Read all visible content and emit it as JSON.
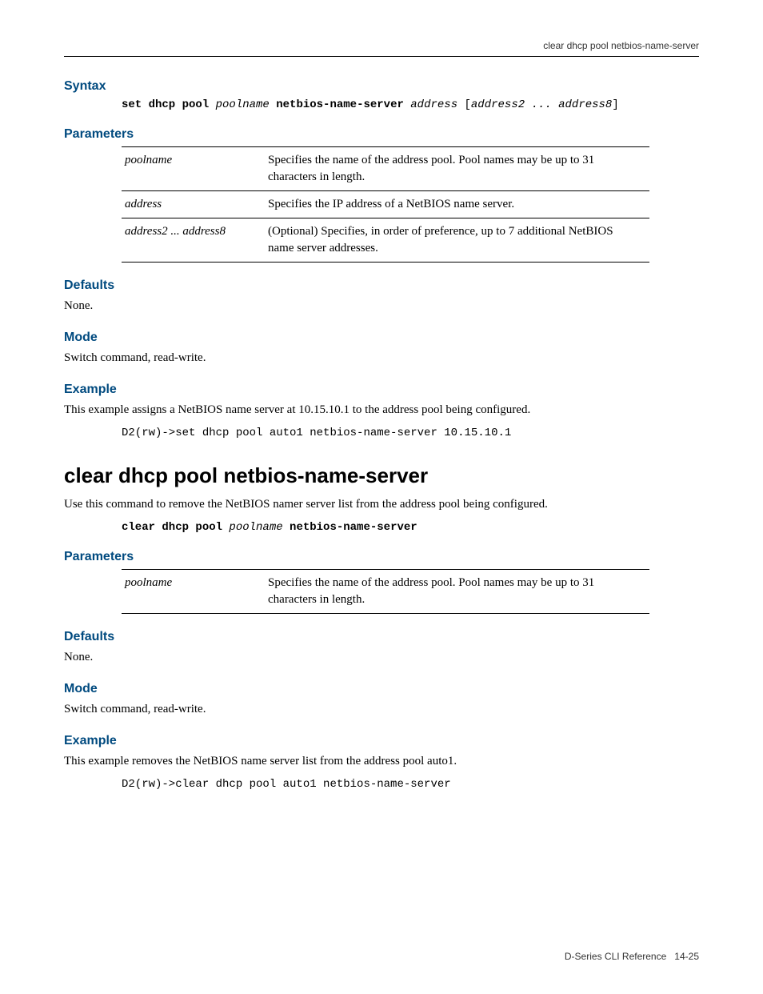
{
  "running_head": "clear dhcp pool netbios-name-server",
  "section1": {
    "syntax_head": "Syntax",
    "syntax_parts": {
      "p1": "set dhcp pool ",
      "p2": "poolname ",
      "p3": "netbios-name-server ",
      "p4": "address ",
      "p5": "[",
      "p6": "address2 ... address8",
      "p7": "]"
    },
    "params_head": "Parameters",
    "params": [
      {
        "name": "poolname",
        "desc": "Specifies the name of the address pool. Pool names may be up to 31 characters in length."
      },
      {
        "name": "address",
        "desc": "Specifies the IP address of a NetBIOS name server."
      },
      {
        "name": "address2 ... address8",
        "desc": "(Optional) Specifies, in order of preference, up to 7 additional NetBIOS name server addresses."
      }
    ],
    "defaults_head": "Defaults",
    "defaults_text": "None.",
    "mode_head": "Mode",
    "mode_text": "Switch command, read‐write.",
    "example_head": "Example",
    "example_text": "This example assigns a NetBIOS name server at 10.15.10.1 to the address pool being configured.",
    "example_code": "D2(rw)->set dhcp pool auto1 netbios-name-server 10.15.10.1"
  },
  "section2": {
    "title": "clear dhcp pool netbios-name-server",
    "intro": "Use this command to remove the NetBIOS namer server list from the address pool being configured.",
    "syntax_parts": {
      "p1": "clear dhcp pool ",
      "p2": "poolname ",
      "p3": "netbios-name-server"
    },
    "params_head": "Parameters",
    "params": [
      {
        "name": "poolname",
        "desc": "Specifies the name of the address pool. Pool names may be up to 31 characters in length."
      }
    ],
    "defaults_head": "Defaults",
    "defaults_text": "None.",
    "mode_head": "Mode",
    "mode_text": "Switch command, read‐write.",
    "example_head": "Example",
    "example_text": "This example removes the NetBIOS name server list from the address pool auto1.",
    "example_code": "D2(rw)->clear dhcp pool auto1 netbios-name-server"
  },
  "footer": {
    "book": "D-Series CLI Reference",
    "page": "14-25"
  }
}
